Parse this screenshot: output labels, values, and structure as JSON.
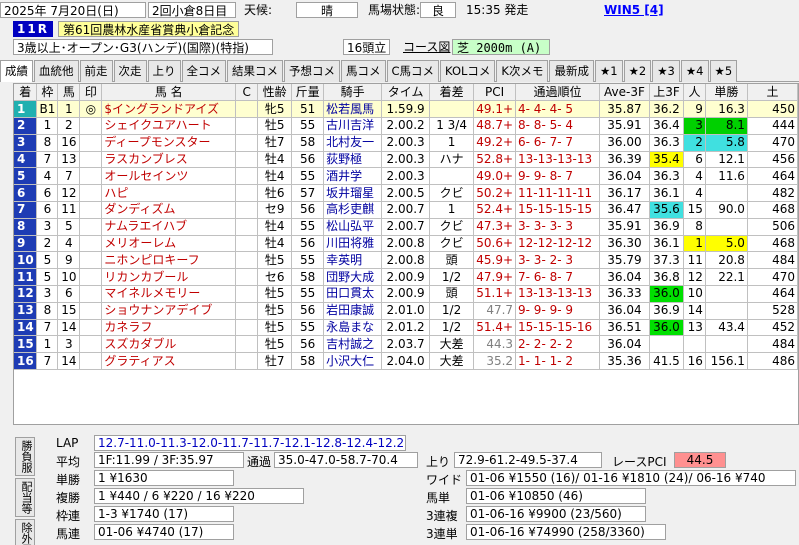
{
  "header": {
    "date": "2025年 7月20日(日)",
    "meeting": "2回小倉8日目",
    "weather_label": "天候:",
    "weather": "晴",
    "track_label": "馬場状態:",
    "track": "良",
    "start_time": "15:35 発走",
    "win5": "WIN5 [4]",
    "race_no": "11R",
    "race_name": "第61回農林水産省賞典小倉記念",
    "conditions": "3歳以上･オープン･G3(ハンデ)(国際)(特指)",
    "runners": "16頭立",
    "course_link": "コース図",
    "surface": "芝 2000m (A)"
  },
  "tabs": [
    "成績",
    "血統他",
    "前走",
    "次走",
    "上り",
    "全コメ",
    "結果コメ",
    "予想コメ",
    "馬コメ",
    "C馬コメ",
    "KOLコメ",
    "K次メモ",
    "最新成",
    "★1",
    "★2",
    "★3",
    "★4",
    "★5"
  ],
  "columns": [
    "着",
    "枠",
    "馬",
    "印",
    "馬 名",
    "C",
    "性齢",
    "斤量",
    "騎手",
    "タイム",
    "着差",
    "PCI",
    "通過順位",
    "Ave-3F",
    "上3F",
    "人",
    "単勝",
    "土"
  ],
  "rows": [
    {
      "pos": "1",
      "waku": "B1",
      "num": "1",
      "mark": "◎",
      "name": "$イングランドアイズ",
      "c": "",
      "sex": "牝5",
      "wt": "51",
      "jockey": "松若風馬",
      "time": "1.59.9",
      "margin": "",
      "pci": "49.1+",
      "pass": "4- 4- 4- 5",
      "ave": "35.87",
      "l3f": "36.2",
      "pop": "9",
      "odds": "16.3",
      "extra": "450"
    },
    {
      "pos": "2",
      "waku": "1",
      "num": "2",
      "mark": "",
      "name": "シェイクユアハート",
      "c": "",
      "sex": "牡5",
      "wt": "55",
      "jockey": "古川吉洋",
      "time": "2.00.2",
      "margin": "1 3/4",
      "pci": "48.7+",
      "pass": "8- 8- 5- 4",
      "ave": "35.91",
      "l3f": "36.4",
      "pop": "3",
      "odds": "8.1",
      "extra": "444"
    },
    {
      "pos": "3",
      "waku": "8",
      "num": "16",
      "mark": "",
      "name": "ディープモンスター",
      "c": "",
      "sex": "牡7",
      "wt": "58",
      "jockey": "北村友一",
      "time": "2.00.3",
      "margin": "1",
      "pci": "49.2+",
      "pass": "6- 6- 7- 7",
      "ave": "36.00",
      "l3f": "36.3",
      "pop": "2",
      "odds": "5.8",
      "extra": "470"
    },
    {
      "pos": "4",
      "waku": "7",
      "num": "13",
      "mark": "",
      "name": "ラスカンブレス",
      "c": "",
      "sex": "牡4",
      "wt": "56",
      "jockey": "荻野極",
      "time": "2.00.3",
      "margin": "ハナ",
      "pci": "52.8+",
      "pass": "13-13-13-13",
      "ave": "36.39",
      "l3f": "35.4",
      "pop": "6",
      "odds": "12.1",
      "extra": "456"
    },
    {
      "pos": "5",
      "waku": "4",
      "num": "7",
      "mark": "",
      "name": "オールセインツ",
      "c": "",
      "sex": "牡4",
      "wt": "55",
      "jockey": "酒井学",
      "time": "2.00.3",
      "margin": "",
      "pci": "49.0+",
      "pass": "9- 9- 8- 7",
      "ave": "36.04",
      "l3f": "36.3",
      "pop": "4",
      "odds": "11.6",
      "extra": "464"
    },
    {
      "pos": "6",
      "waku": "6",
      "num": "12",
      "mark": "",
      "name": "ハピ",
      "c": "",
      "sex": "牡6",
      "wt": "57",
      "jockey": "坂井瑠星",
      "time": "2.00.5",
      "margin": "クビ",
      "pci": "50.2+",
      "pass": "11-11-11-11",
      "ave": "36.17",
      "l3f": "36.1",
      "pop": "4",
      "odds": "",
      "extra": "482"
    },
    {
      "pos": "7",
      "waku": "6",
      "num": "11",
      "mark": "",
      "name": "ダンディズム",
      "c": "",
      "sex": "セ9",
      "wt": "56",
      "jockey": "高杉吏麒",
      "time": "2.00.7",
      "margin": "1",
      "pci": "52.4+",
      "pass": "15-15-15-15",
      "ave": "36.47",
      "l3f": "35.6",
      "pop": "15",
      "odds": "90.0",
      "extra": "468"
    },
    {
      "pos": "8",
      "waku": "3",
      "num": "5",
      "mark": "",
      "name": "ナムラエイハブ",
      "c": "",
      "sex": "牡4",
      "wt": "55",
      "jockey": "松山弘平",
      "time": "2.00.7",
      "margin": "クビ",
      "pci": "47.3+",
      "pass": "3- 3- 3- 3",
      "ave": "35.91",
      "l3f": "36.9",
      "pop": "8",
      "odds": "",
      "extra": "506"
    },
    {
      "pos": "9",
      "waku": "2",
      "num": "4",
      "mark": "",
      "name": "メリオーレム",
      "c": "",
      "sex": "牡4",
      "wt": "56",
      "jockey": "川田将雅",
      "time": "2.00.8",
      "margin": "クビ",
      "pci": "50.6+",
      "pass": "12-12-12-12",
      "ave": "36.30",
      "l3f": "36.1",
      "pop": "1",
      "odds": "5.0",
      "extra": "468"
    },
    {
      "pos": "10",
      "waku": "5",
      "num": "9",
      "mark": "",
      "name": "ニホンピロキーフ",
      "c": "",
      "sex": "牡5",
      "wt": "55",
      "jockey": "幸英明",
      "time": "2.00.8",
      "margin": "頭",
      "pci": "45.9+",
      "pass": "3- 3- 2- 3",
      "ave": "35.79",
      "l3f": "37.3",
      "pop": "11",
      "odds": "20.8",
      "extra": "484"
    },
    {
      "pos": "11",
      "waku": "5",
      "num": "10",
      "mark": "",
      "name": "リカンカブール",
      "c": "",
      "sex": "セ6",
      "wt": "58",
      "jockey": "団野大成",
      "time": "2.00.9",
      "margin": "1/2",
      "pci": "47.9+",
      "pass": "7- 6- 8- 7",
      "ave": "36.04",
      "l3f": "36.8",
      "pop": "12",
      "odds": "22.1",
      "extra": "470"
    },
    {
      "pos": "12",
      "waku": "3",
      "num": "6",
      "mark": "",
      "name": "マイネルメモリー",
      "c": "",
      "sex": "牡5",
      "wt": "55",
      "jockey": "田口貫太",
      "time": "2.00.9",
      "margin": "頭",
      "pci": "51.1+",
      "pass": "13-13-13-13",
      "ave": "36.33",
      "l3f": "36.0",
      "pop": "10",
      "odds": "",
      "extra": "464"
    },
    {
      "pos": "13",
      "waku": "8",
      "num": "15",
      "mark": "",
      "name": "ショウナンアデイブ",
      "c": "",
      "sex": "牡5",
      "wt": "56",
      "jockey": "岩田康誠",
      "time": "2.01.0",
      "margin": "1/2",
      "pci": "47.7",
      "pass": "9- 9- 9- 9",
      "ave": "36.04",
      "l3f": "36.9",
      "pop": "14",
      "odds": "",
      "extra": "528"
    },
    {
      "pos": "14",
      "waku": "7",
      "num": "14",
      "mark": "",
      "name": "カネラフ",
      "c": "",
      "sex": "牡5",
      "wt": "55",
      "jockey": "永島まな",
      "time": "2.01.2",
      "margin": "1/2",
      "pci": "51.4+",
      "pass": "15-15-15-16",
      "ave": "36.51",
      "l3f": "36.0",
      "pop": "13",
      "odds": "43.4",
      "extra": "452"
    },
    {
      "pos": "15",
      "waku": "1",
      "num": "3",
      "mark": "",
      "name": "スズカダブル",
      "c": "",
      "sex": "牡5",
      "wt": "56",
      "jockey": "吉村誠之",
      "time": "2.03.7",
      "margin": "大差",
      "pci": "44.3",
      "pass": "2- 2- 2- 2",
      "ave": "36.04",
      "l3f": "",
      "pop": "",
      "odds": "",
      "extra": "484"
    },
    {
      "pos": "16",
      "waku": "7",
      "num": "14",
      "mark": "",
      "name": "グラティアス",
      "c": "",
      "sex": "牡7",
      "wt": "58",
      "jockey": "小沢大仁",
      "time": "2.04.0",
      "margin": "大差",
      "pci": "35.2",
      "pass": "1- 1- 1- 2",
      "ave": "35.36",
      "l3f": "41.5",
      "pop": "16",
      "odds": "156.1",
      "extra": "486"
    }
  ],
  "side_tabs": [
    "勝負服",
    "配当等",
    "除外馬"
  ],
  "bottom": {
    "lap_label": "LAP",
    "lap": "12.7-11.0-11.3-12.0-11.7-11.7-12.1-12.8-12.4-12.2",
    "avg_label": "平均",
    "avg": "1F:11.99 / 3F:35.97",
    "pace_label": "通過",
    "pace": "35.0-47.0-58.7-70.4",
    "agari_label": "上り",
    "agari": "72.9-61.2-49.5-37.4",
    "race_pci_label": "レースPCI",
    "race_pci": "44.5",
    "win_label": "単勝",
    "win": "1 ¥1630",
    "place_label": "複勝",
    "place": "1 ¥440 / 6 ¥220 / 16 ¥220",
    "wide_label": "ワイド",
    "wide": "01-06 ¥1550 (16)/ 01-16 ¥1810 (24)/ 06-16 ¥740",
    "bracket_label": "枠連",
    "bracket": "1-3 ¥1740 (17)",
    "exacta_label": "馬単",
    "exacta": "01-06 ¥10850 (46)",
    "quinella_label": "馬連",
    "quinella": "01-06 ¥4740 (17)",
    "trio_label": "3連複",
    "trio": "01-06-16 ¥9900 (23/560)",
    "trifecta_label": "3連単",
    "trifecta": "01-06-16 ¥74990 (258/3360)"
  }
}
